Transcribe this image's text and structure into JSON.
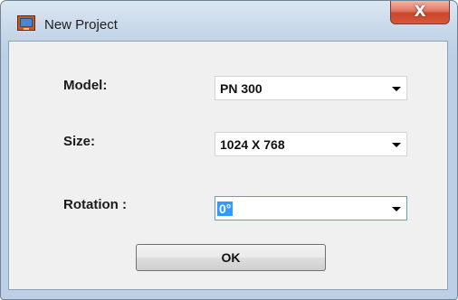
{
  "window": {
    "title": "New Project",
    "icon": "project-icon",
    "close_glyph": "X"
  },
  "form": {
    "model_label": "Model:",
    "model_value": "PN 300",
    "size_label": "Size:",
    "size_value": "1024 X 768",
    "rotation_label": "Rotation :",
    "rotation_value": "0°"
  },
  "buttons": {
    "ok_label": "OK"
  },
  "colors": {
    "close_button": "#d9583c",
    "selection_highlight": "#3399ff",
    "focus_border": "#5a9ee0"
  }
}
